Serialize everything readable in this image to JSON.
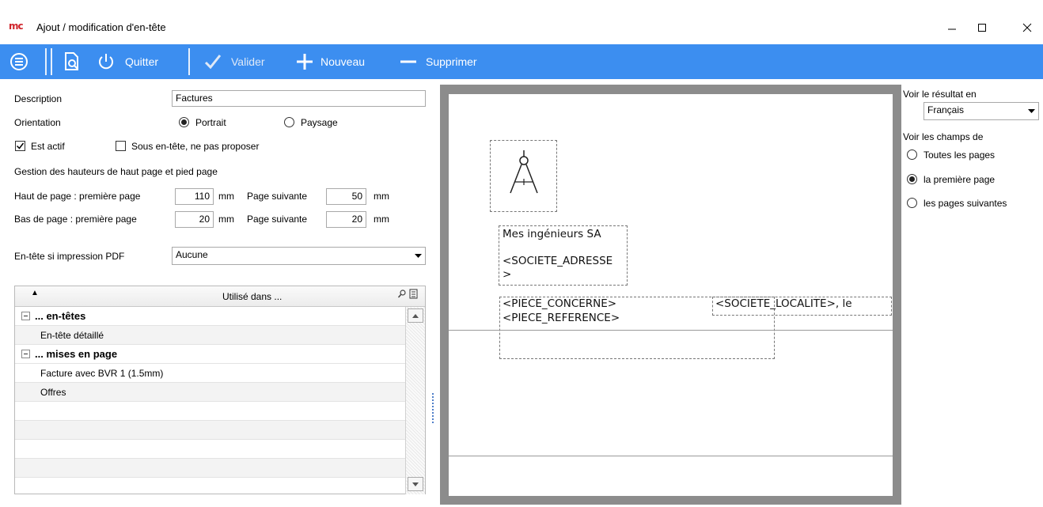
{
  "window": {
    "logo_text": "mc",
    "title": "Ajout / modification d'en-tête"
  },
  "toolbar": {
    "quit_label": "Quitter",
    "validate_label": "Valider",
    "new_label": "Nouveau",
    "delete_label": "Supprimer",
    "accent_color": "#3c8ef0"
  },
  "form": {
    "description_label": "Description",
    "description_value": "Factures",
    "orientation_label": "Orientation",
    "orientation_portrait": "Portrait",
    "orientation_landscape": "Paysage",
    "orientation_selected": "Portrait",
    "active_label": "Est actif",
    "active_checked": true,
    "sub_header_label": "Sous en-tête, ne pas proposer",
    "sub_header_checked": false,
    "heights_section_label": "Gestion des hauteurs de haut page et pied page",
    "top_first_label": "Haut de page : première page",
    "top_first_value": "110",
    "top_next_label": "Page suivante",
    "top_next_value": "50",
    "bottom_first_label": "Bas de page  : première page",
    "bottom_first_value": "20",
    "bottom_next_label": "Page suivante",
    "bottom_next_value": "20",
    "unit_mm": "mm",
    "pdf_label": "En-tête si impression PDF",
    "pdf_value": "Aucune"
  },
  "grid": {
    "sort_indicator": "▲",
    "column_header": "Utilisé dans ...",
    "rows": [
      {
        "type": "group",
        "label": "... en-têtes"
      },
      {
        "type": "item",
        "label": "En-tête détaillé"
      },
      {
        "type": "group",
        "label": "... mises en page"
      },
      {
        "type": "item",
        "label": "Facture avec BVR 1 (1.5mm)"
      },
      {
        "type": "item",
        "label": "Offres"
      }
    ]
  },
  "preview": {
    "company_name": "Mes ingénieurs SA",
    "address_field_1": "<SOCIETE_ADRESSE",
    "address_field_2": ">",
    "piece_concerne": "<PIECE_CONCERNE>",
    "piece_reference": "<PIECE_REFERENCE>",
    "localite": "<SOCIETE_LOCALITE>, le"
  },
  "side": {
    "result_label": "Voir le résultat en",
    "language_value": "Français",
    "fields_label": "Voir les champs de",
    "opt_all_pages": "Toutes les pages",
    "opt_first_page": "la première page",
    "opt_next_pages": "les pages suivantes",
    "selected_option": "la première page"
  }
}
